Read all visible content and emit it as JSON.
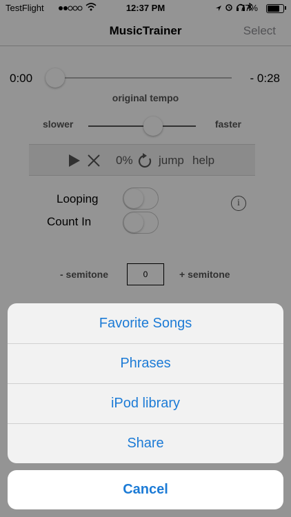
{
  "status_bar": {
    "carrier": "TestFlight",
    "time": "12:37 PM",
    "battery": "77%"
  },
  "nav": {
    "title": "MusicTrainer",
    "select_label": "Select"
  },
  "player": {
    "elapsed": "0:00",
    "remaining": "- 0:28",
    "position_fraction": 0.0,
    "tempo_label": "original tempo",
    "slower_label": "slower",
    "faster_label": "faster",
    "tempo_fraction": 0.6,
    "speed_pct": "0%",
    "jump_label": "jump",
    "help_label": "help"
  },
  "options": {
    "looping_label": "Looping",
    "looping_on": false,
    "count_in_label": "Count In",
    "count_in_on": false,
    "info_glyph": "i"
  },
  "semitone": {
    "minus_label": "- semitone",
    "value": "0",
    "plus_label": "+ semitone"
  },
  "action_sheet": {
    "items": [
      "Favorite Songs",
      "Phrases",
      "iPod library",
      "Share"
    ],
    "cancel_label": "Cancel",
    "accent": "#1c7bd6"
  }
}
